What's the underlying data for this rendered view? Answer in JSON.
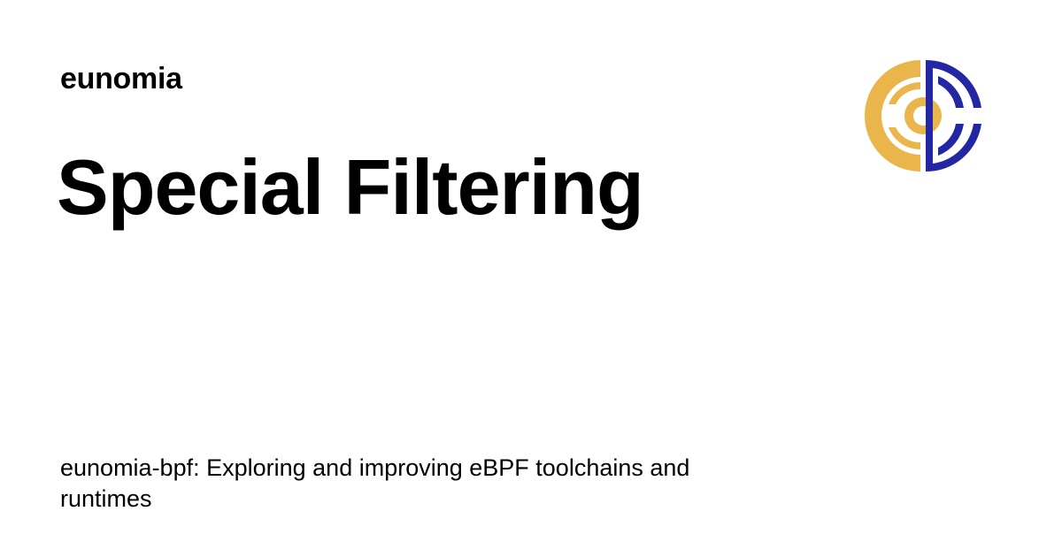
{
  "site": {
    "name": "eunomia"
  },
  "page": {
    "title": "Special Filtering",
    "description": "eunomia-bpf: Exploring and improving eBPF toolchains and runtimes"
  },
  "logo": {
    "icon": "eunomia-logo-icon",
    "colors": {
      "gold": "#EAB54A",
      "navy": "#2327A3"
    }
  }
}
